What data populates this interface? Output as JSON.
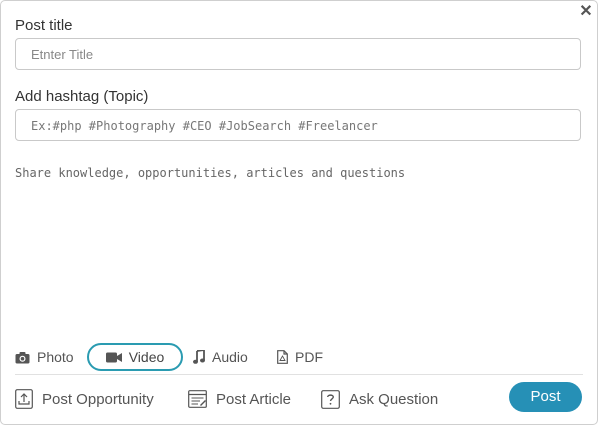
{
  "title_section": {
    "label": "Post title",
    "placeholder": "Etnter Title"
  },
  "hashtag_section": {
    "label": "Add hashtag (Topic)",
    "placeholder": "Ex:#php #Photography #CEO #JobSearch #Freelancer"
  },
  "body_placeholder": "Share knowledge, opportunities, articles and questions",
  "media_tabs": [
    {
      "label": "Photo",
      "icon": "camera-icon"
    },
    {
      "label": "Video",
      "icon": "video-camera-icon",
      "active": true
    },
    {
      "label": "Audio",
      "icon": "music-note-icon"
    },
    {
      "label": "PDF",
      "icon": "pdf-file-icon"
    }
  ],
  "actions": [
    {
      "label": "Post Opportunity",
      "icon": "upload-icon"
    },
    {
      "label": "Post Article",
      "icon": "article-icon"
    },
    {
      "label": "Ask Question",
      "icon": "question-icon"
    }
  ],
  "post_button": "Post",
  "colors": {
    "accent": "#2690b6",
    "active_border": "#2a9bb1"
  }
}
